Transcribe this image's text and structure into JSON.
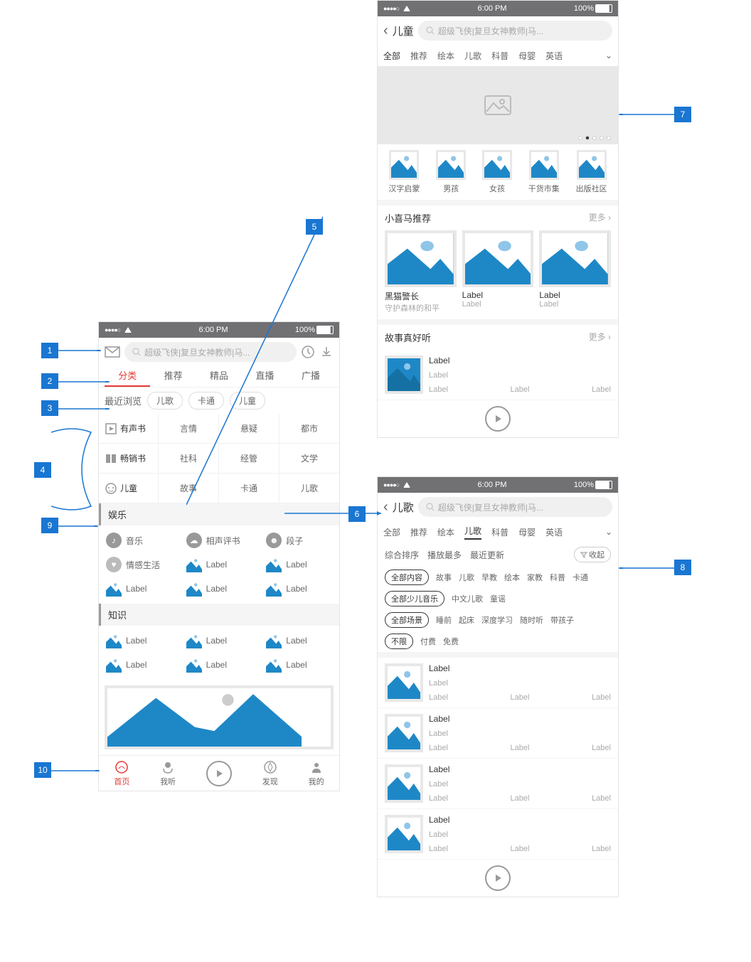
{
  "status": {
    "time": "6:00 PM",
    "battery": "100%"
  },
  "s1": {
    "search": "超级飞侠|复旦女神教师|马...",
    "tabs": [
      "分类",
      "推荐",
      "精品",
      "直播",
      "广播"
    ],
    "recent": "最近浏览",
    "recentItems": [
      "儿歌",
      "卡通",
      "儿童"
    ],
    "gridRows": [
      {
        "head": "有声书",
        "cells": [
          "言情",
          "悬疑",
          "都市"
        ]
      },
      {
        "head": "畅销书",
        "cells": [
          "社科",
          "经管",
          "文学"
        ]
      },
      {
        "head": "儿童",
        "cells": [
          "故事",
          "卡通",
          "儿歌"
        ]
      }
    ],
    "yule": "娱乐",
    "yuleItems": [
      "音乐",
      "相声评书",
      "段子",
      "情感生活",
      "Label",
      "Label",
      "Label",
      "Label",
      "Label"
    ],
    "zhishi": "知识",
    "zhishiItems": [
      "Label",
      "Label",
      "Label",
      "Label",
      "Label",
      "Label"
    ],
    "nav": [
      "首页",
      "我听",
      "",
      "发现",
      "我的"
    ]
  },
  "s2": {
    "title": "儿童",
    "search": "超级飞侠|复旦女神教师|马...",
    "tabs": [
      "全部",
      "推荐",
      "绘本",
      "儿歌",
      "科普",
      "母婴",
      "英语"
    ],
    "cats": [
      "汉字启蒙",
      "男孩",
      "女孩",
      "干货市集",
      "出版社区"
    ],
    "sec1": "小喜马推荐",
    "more": "更多",
    "cards": [
      {
        "t": "黑猫警长",
        "s": "守护森林的和平"
      },
      {
        "t": "Label",
        "s": "Label"
      },
      {
        "t": "Label",
        "s": "Label"
      }
    ],
    "sec2": "故事真好听",
    "item": {
      "t": "Label",
      "s": "Label",
      "a": "Label",
      "b": "Label",
      "c": "Label"
    }
  },
  "s3": {
    "title": "儿歌",
    "search": "超级飞侠|复旦女神教师|马...",
    "tabs": [
      "全部",
      "推荐",
      "绘本",
      "儿歌",
      "科普",
      "母婴",
      "英语"
    ],
    "sort": [
      "综合排序",
      "播放最多",
      "最近更新"
    ],
    "collapse": "收起",
    "f1": [
      "全部内容",
      "故事",
      "儿歌",
      "早教",
      "绘本",
      "家教",
      "科普",
      "卡通"
    ],
    "f2": [
      "全部少儿音乐",
      "中文儿歌",
      "童谣"
    ],
    "f3": [
      "全部场景",
      "睡前",
      "起床",
      "深度学习",
      "随时听",
      "带孩子"
    ],
    "f4": [
      "不限",
      "付费",
      "免费"
    ],
    "items": [
      {
        "t": "Label",
        "s": "Label",
        "a": "Label",
        "b": "Label",
        "c": "Label"
      },
      {
        "t": "Label",
        "s": "Label",
        "a": "Label",
        "b": "Label",
        "c": "Label"
      },
      {
        "t": "Label",
        "s": "Label",
        "a": "Label",
        "b": "Label",
        "c": "Label"
      },
      {
        "t": "Label",
        "s": "Label",
        "a": "Label",
        "b": "Label",
        "c": "Label"
      }
    ]
  },
  "markers": [
    "1",
    "2",
    "3",
    "4",
    "5",
    "6",
    "7",
    "8",
    "9",
    "10"
  ],
  "chart_data": {
    "type": "area",
    "note": "decorative banner mountain-shape, no axes",
    "series": [
      {
        "name": "shape",
        "values": [
          0,
          60,
          30,
          25,
          80,
          10,
          0
        ]
      }
    ]
  }
}
